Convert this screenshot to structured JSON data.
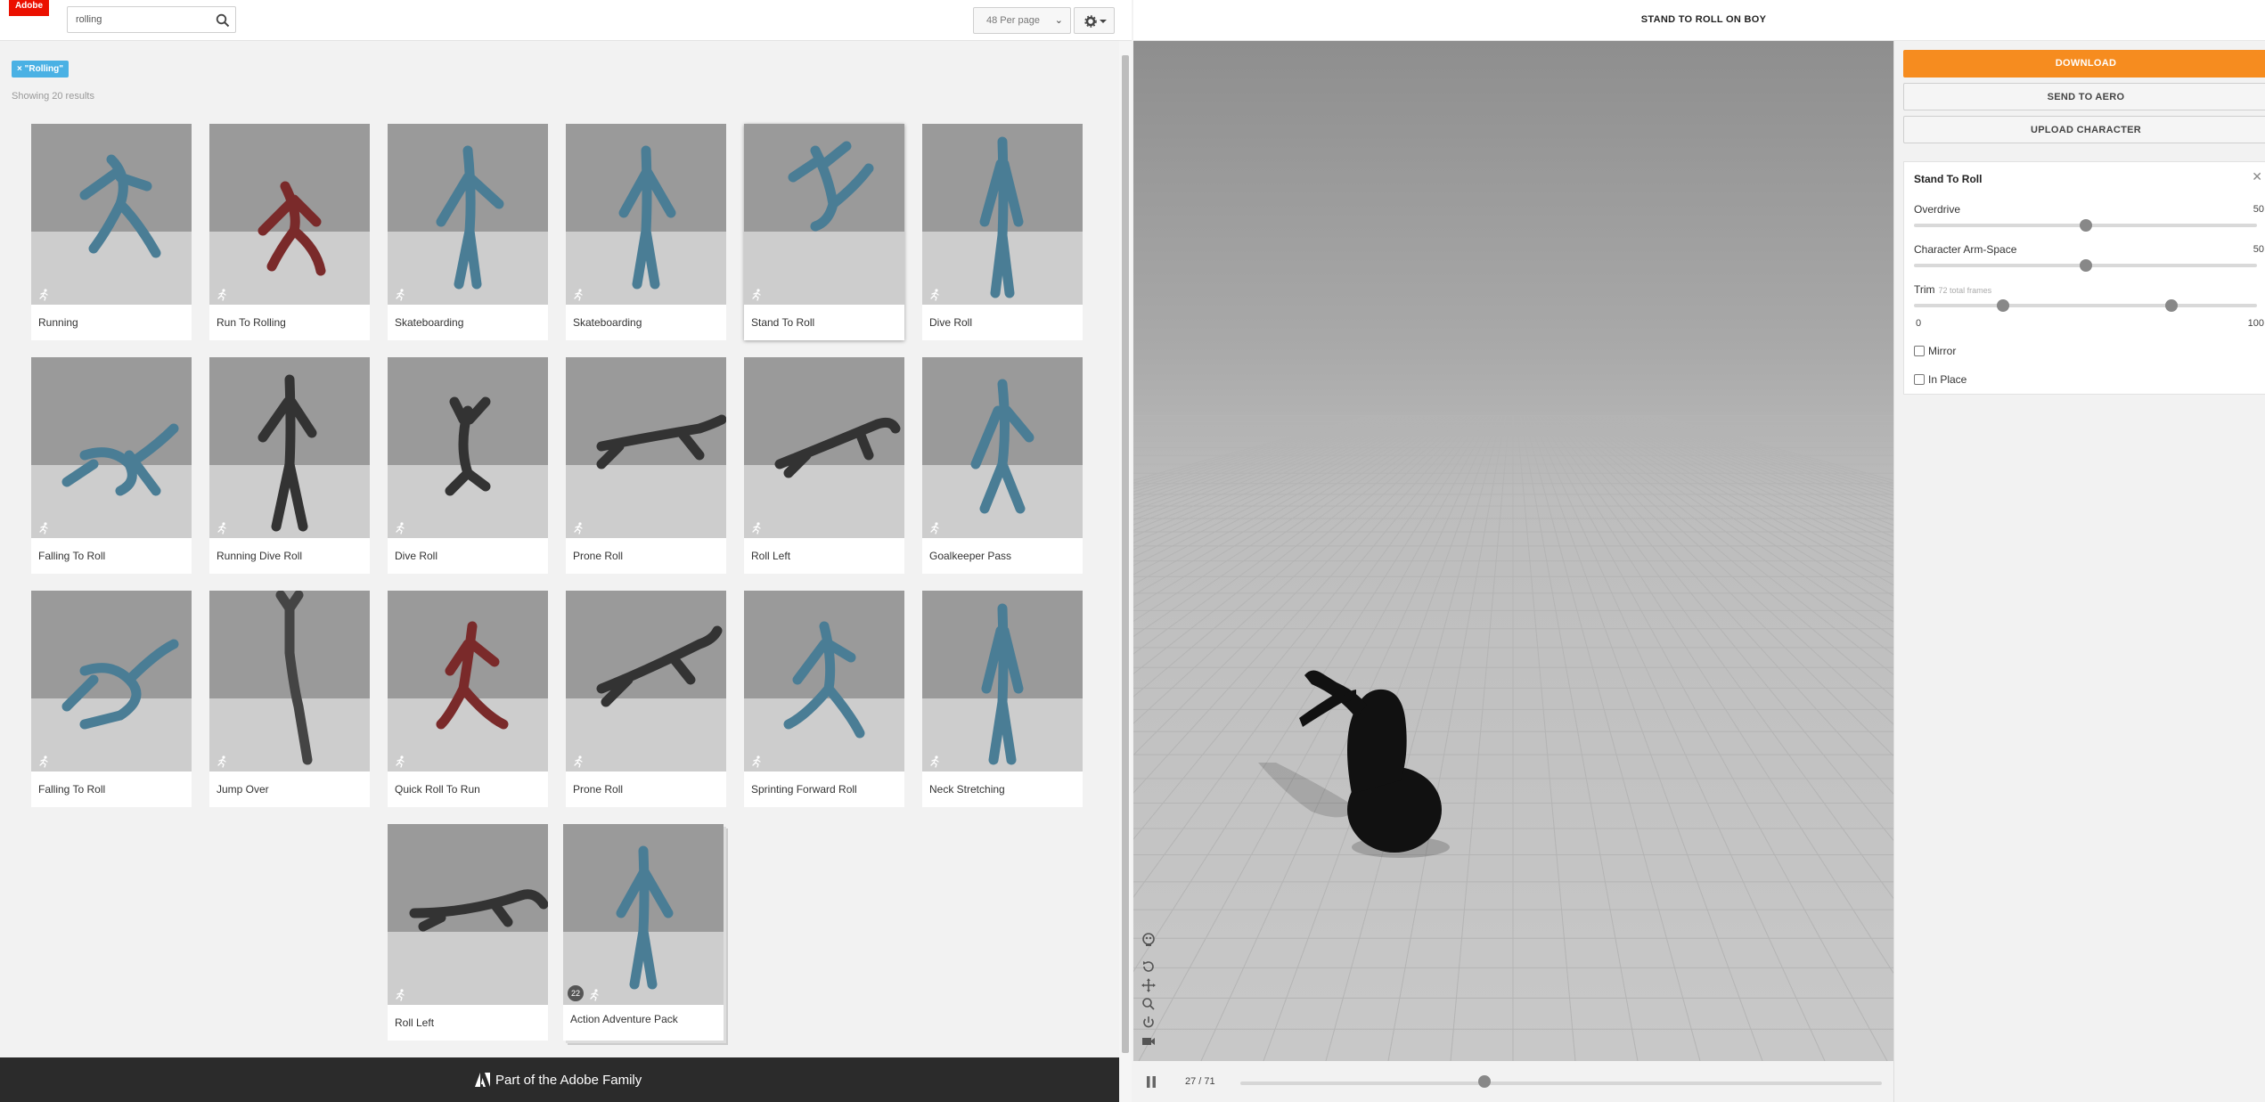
{
  "app": {
    "logo_text": "Adobe",
    "accent": "#eb1000",
    "download_color": "#f68c1f",
    "tag_color": "#4ab1e4"
  },
  "search": {
    "value": "rolling",
    "per_page": "48 Per page"
  },
  "filter": {
    "tag": "× \"Rolling\"",
    "results_count": "Showing 20 results"
  },
  "cards": [
    {
      "label": "Running"
    },
    {
      "label": "Run To Rolling"
    },
    {
      "label": "Skateboarding"
    },
    {
      "label": "Skateboarding"
    },
    {
      "label": "Stand To Roll"
    },
    {
      "label": "Dive Roll"
    },
    {
      "label": "Falling To Roll"
    },
    {
      "label": "Running Dive Roll"
    },
    {
      "label": "Dive Roll"
    },
    {
      "label": "Prone Roll"
    },
    {
      "label": "Roll Left"
    },
    {
      "label": "Goalkeeper Pass"
    },
    {
      "label": "Falling To Roll"
    },
    {
      "label": "Jump Over"
    },
    {
      "label": "Quick Roll To Run"
    },
    {
      "label": "Prone Roll"
    },
    {
      "label": "Sprinting Forward Roll"
    },
    {
      "label": "Neck Stretching"
    },
    {
      "label": "Roll Left"
    },
    {
      "label": "Action Adventure Pack",
      "badge": "22"
    }
  ],
  "footer": {
    "text": "Part of the Adobe Family"
  },
  "viewer": {
    "title": "STAND TO ROLL ON BOY",
    "frame_current": "27",
    "frame_total": "71",
    "frame_display": "27 / 71",
    "progress": 0.38
  },
  "actions": {
    "download": "DOWNLOAD",
    "send_aero": "SEND TO AERO",
    "upload": "UPLOAD CHARACTER"
  },
  "settings": {
    "title": "Stand To Roll",
    "overdrive_label": "Overdrive",
    "overdrive_value": "50",
    "overdrive_fraction": 0.5,
    "armspace_label": "Character Arm-Space",
    "armspace_value": "50",
    "armspace_fraction": 0.5,
    "trim_label": "Trim",
    "trim_sub": "72 total frames",
    "trim_min_label": "0",
    "trim_max_label": "100",
    "trim_start_fraction": 0.26,
    "trim_end_fraction": 0.75,
    "mirror_label": "Mirror",
    "inplace_label": "In Place"
  }
}
